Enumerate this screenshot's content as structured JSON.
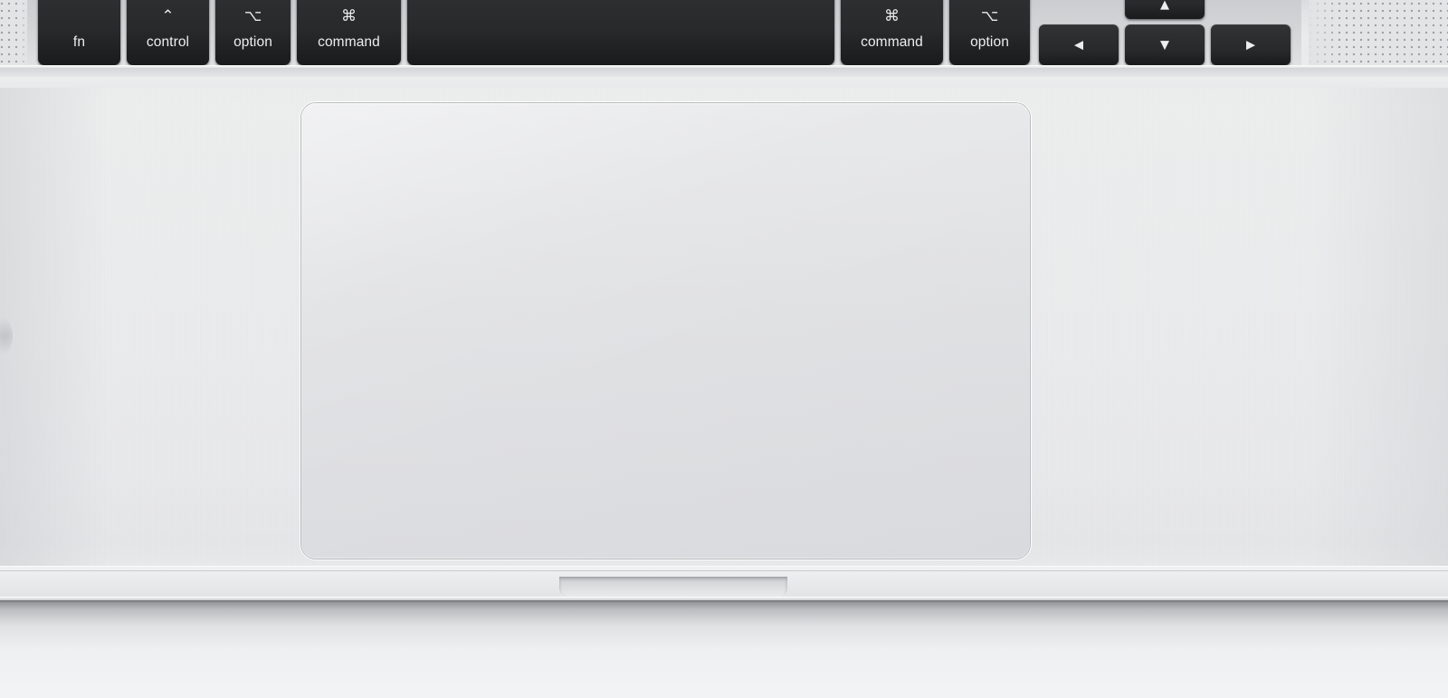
{
  "scene": {
    "subject": "MacBook keyboard bottom row, trackpad and palm rest close-up",
    "device": "MacBook",
    "finish": "Silver aluminium"
  },
  "colors": {
    "deck_aluminium": "#eaebec",
    "key_black": "#2b2c2e",
    "key_text": "#ededee",
    "trackpad_fill": "#e0e1e3",
    "trackpad_groove": "#a0a3a7",
    "grille_hole": "#9a9c9f",
    "surface_below": "#f3f4f5",
    "shadow": "#6a6c70"
  },
  "keyboard": {
    "region_name": "bottom-row",
    "keys": [
      {
        "id": "fn",
        "label": "fn",
        "glyph": ""
      },
      {
        "id": "control",
        "label": "control",
        "glyph": "⌃"
      },
      {
        "id": "option-l",
        "label": "option",
        "glyph": "⌥"
      },
      {
        "id": "command-l",
        "label": "command",
        "glyph": "⌘"
      },
      {
        "id": "space",
        "label": "",
        "glyph": ""
      },
      {
        "id": "command-r",
        "label": "command",
        "glyph": "⌘"
      },
      {
        "id": "option-r",
        "label": "option",
        "glyph": "⌥"
      }
    ],
    "arrow_keys": [
      {
        "id": "left",
        "glyph": "◀",
        "name": "arrow-left"
      },
      {
        "id": "up",
        "glyph": "▲",
        "name": "arrow-up"
      },
      {
        "id": "down",
        "glyph": "▼",
        "name": "arrow-down"
      },
      {
        "id": "right",
        "glyph": "▶",
        "name": "arrow-right"
      }
    ]
  },
  "speakers": {
    "left_label": "left speaker grille",
    "right_label": "right speaker grille",
    "pattern": "perforated square hole grid"
  },
  "trackpad": {
    "label": "Force Touch trackpad",
    "shape": "rounded rectangle"
  },
  "front_edge": {
    "notch_label": "lid-opening finger notch"
  }
}
